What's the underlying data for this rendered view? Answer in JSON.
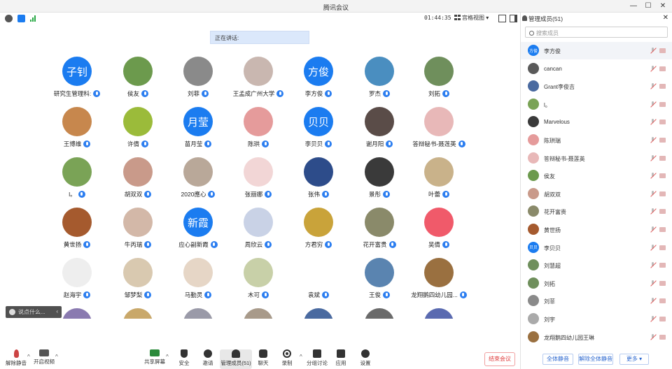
{
  "window": {
    "title": "腾讯会议"
  },
  "meeting": {
    "timer": "01:44:35",
    "view_label": "宫格视图",
    "speaking_label": "正在讲话:"
  },
  "grid": [
    {
      "name": "研究生管理科:",
      "initials": "子钊",
      "color": "#1b7cf0"
    },
    {
      "name": "侯友",
      "initials": "",
      "color": "#6c9a4d"
    },
    {
      "name": "刘菲",
      "initials": "",
      "color": "#8a8a8a"
    },
    {
      "name": "王孟成广州大学",
      "initials": "",
      "color": "#c9b7b0"
    },
    {
      "name": "李方俊",
      "initials": "方俊",
      "color": "#1b7cf0"
    },
    {
      "name": "罗杰",
      "initials": "",
      "color": "#4a8ec0"
    },
    {
      "name": "刘拓",
      "initials": "",
      "color": "#6f8f5c"
    },
    {
      "name": "王博维",
      "initials": "",
      "color": "#c7874d"
    },
    {
      "name": "许倩",
      "initials": "",
      "color": "#9bbb3a"
    },
    {
      "name": "苗月莹",
      "initials": "月莹",
      "color": "#1b7cf0"
    },
    {
      "name": "陈珙",
      "initials": "",
      "color": "#e59b9b"
    },
    {
      "name": "李贝贝",
      "initials": "贝贝",
      "color": "#1b7cf0"
    },
    {
      "name": "谢月阳",
      "initials": "",
      "color": "#5a4c48"
    },
    {
      "name": "答辩秘书-聂莲英",
      "initials": "",
      "color": "#e8b8b8"
    },
    {
      "name": "l。",
      "initials": "",
      "color": "#7aa356"
    },
    {
      "name": "胡双双",
      "initials": "",
      "color": "#c99a8a"
    },
    {
      "name": "2020應心",
      "initials": "",
      "color": "#b9a899"
    },
    {
      "name": "张丽娜",
      "initials": "",
      "color": "#f2d6d6"
    },
    {
      "name": "张伟",
      "initials": "",
      "color": "#2d4c8a"
    },
    {
      "name": "景彤",
      "initials": "",
      "color": "#3a3a3a"
    },
    {
      "name": "叶蕾",
      "initials": "",
      "color": "#c9b28a"
    },
    {
      "name": "黄世扬",
      "initials": "",
      "color": "#a55a2e"
    },
    {
      "name": "牛丙瑞",
      "initials": "",
      "color": "#d3b8a8"
    },
    {
      "name": "应心副新霞",
      "initials": "新霞",
      "color": "#1b7cf0"
    },
    {
      "name": "周欣云",
      "initials": "",
      "color": "#c9d2e6"
    },
    {
      "name": "方君穷",
      "initials": "",
      "color": "#c9a33a"
    },
    {
      "name": "花开富贵",
      "initials": "",
      "color": "#8a8a6a"
    },
    {
      "name": "吴倩",
      "initials": "",
      "color": "#f05a6a"
    },
    {
      "name": "赵海宇",
      "initials": "",
      "color": "#eeeeee"
    },
    {
      "name": "邹梦梨",
      "initials": "",
      "color": "#d9c9b0"
    },
    {
      "name": "马勤灵",
      "initials": "",
      "color": "#e6d6c6"
    },
    {
      "name": "木可",
      "initials": "",
      "color": "#c8d0a8"
    },
    {
      "name": "袁斌",
      "initials": "",
      "color": "#ffffff"
    },
    {
      "name": "王俊",
      "initials": "",
      "color": "#5a84b0"
    },
    {
      "name": "龙翔鹅四幼儿园...",
      "initials": "",
      "color": "#9a7040"
    },
    {
      "name": "",
      "initials": "",
      "color": "#8a7ab0"
    },
    {
      "name": "",
      "initials": "",
      "color": "#c9a86a"
    },
    {
      "name": "",
      "initials": "",
      "color": "#9a9aa8"
    },
    {
      "name": "",
      "initials": "",
      "color": "#a89a8a"
    },
    {
      "name": "",
      "initials": "",
      "color": "#4a6aa0"
    },
    {
      "name": "",
      "initials": "",
      "color": "#6a6a6a"
    },
    {
      "name": "",
      "initials": "",
      "color": "#5a6ab0"
    }
  ],
  "chat_prompt": "说点什么...",
  "toolbar": {
    "mute": "解除静音",
    "video": "开启视频",
    "share": "共享屏幕",
    "security": "安全",
    "invite": "邀请",
    "members": "管理成员(51)",
    "chat": "聊天",
    "record": "录制",
    "breakout": "分组讨论",
    "apps": "应用",
    "settings": "设置",
    "end": "结束会议"
  },
  "panel": {
    "title": "管理成员(51)",
    "search_placeholder": "搜索成员",
    "members": [
      {
        "name": "李方俊",
        "initials": "方俊",
        "color": "#1b7cf0"
      },
      {
        "name": "cancan",
        "initials": "",
        "color": "#5a5a5a"
      },
      {
        "name": "Grant李俊吉",
        "initials": "",
        "color": "#4a6aa0"
      },
      {
        "name": "l。",
        "initials": "",
        "color": "#7aa356"
      },
      {
        "name": "Marvelous",
        "initials": "",
        "color": "#3a3a3a"
      },
      {
        "name": "陈珙瑞",
        "initials": "",
        "color": "#e59b9b"
      },
      {
        "name": "答辩秘书-聂莲英",
        "initials": "",
        "color": "#e8b8b8"
      },
      {
        "name": "侯友",
        "initials": "",
        "color": "#6c9a4d"
      },
      {
        "name": "胡双双",
        "initials": "",
        "color": "#c99a8a"
      },
      {
        "name": "花开富贵",
        "initials": "",
        "color": "#8a8a6a"
      },
      {
        "name": "黄世扬",
        "initials": "",
        "color": "#a55a2e"
      },
      {
        "name": "李贝贝",
        "initials": "贝贝",
        "color": "#1b7cf0"
      },
      {
        "name": "刘慧超",
        "initials": "",
        "color": "#6f8f5c"
      },
      {
        "name": "刘拓",
        "initials": "",
        "color": "#6f8f5c"
      },
      {
        "name": "刘菲",
        "initials": "",
        "color": "#8a8a8a"
      },
      {
        "name": "刘宇",
        "initials": "",
        "color": "#aaaaaa"
      },
      {
        "name": "龙翔鹅四幼儿园王琳",
        "initials": "",
        "color": "#9a7040"
      },
      {
        "name": "",
        "initials": "",
        "color": "#b0a090"
      }
    ],
    "mute_all": "全体静音",
    "unmute_all": "解除全体静音",
    "more": "更多 ▾"
  }
}
